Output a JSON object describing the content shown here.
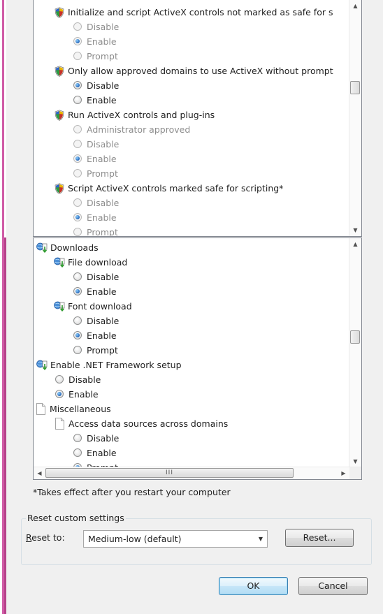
{
  "panel1": {
    "items": [
      {
        "kind": "header",
        "icon": "shield-icon",
        "text": "Initialize and script ActiveX controls not marked as safe for s",
        "indent": 30
      },
      {
        "kind": "radio",
        "text": "Disable",
        "checked": false,
        "dim": true,
        "indent": 57
      },
      {
        "kind": "radio",
        "text": "Enable",
        "checked": true,
        "dim": true,
        "indent": 57
      },
      {
        "kind": "radio",
        "text": "Prompt",
        "checked": false,
        "dim": true,
        "indent": 57
      },
      {
        "kind": "header",
        "icon": "shield-icon",
        "text": "Only allow approved domains to use ActiveX without prompt",
        "indent": 30
      },
      {
        "kind": "radio",
        "text": "Disable",
        "checked": true,
        "dim": false,
        "indent": 57
      },
      {
        "kind": "radio",
        "text": "Enable",
        "checked": false,
        "dim": false,
        "indent": 57
      },
      {
        "kind": "header",
        "icon": "shield-icon",
        "text": "Run ActiveX controls and plug-ins",
        "indent": 30
      },
      {
        "kind": "radio",
        "text": "Administrator approved",
        "checked": false,
        "dim": true,
        "indent": 57
      },
      {
        "kind": "radio",
        "text": "Disable",
        "checked": false,
        "dim": true,
        "indent": 57
      },
      {
        "kind": "radio",
        "text": "Enable",
        "checked": true,
        "dim": true,
        "indent": 57
      },
      {
        "kind": "radio",
        "text": "Prompt",
        "checked": false,
        "dim": true,
        "indent": 57
      },
      {
        "kind": "header",
        "icon": "shield-icon",
        "text": "Script ActiveX controls marked safe for scripting*",
        "indent": 30
      },
      {
        "kind": "radio",
        "text": "Disable",
        "checked": false,
        "dim": true,
        "indent": 57
      },
      {
        "kind": "radio",
        "text": "Enable",
        "checked": true,
        "dim": true,
        "indent": 57
      },
      {
        "kind": "radio",
        "text": "Prompt",
        "checked": false,
        "dim": true,
        "indent": 57
      }
    ]
  },
  "panel2": {
    "items": [
      {
        "kind": "header",
        "icon": "download-icon",
        "text": "Downloads",
        "indent": 4
      },
      {
        "kind": "header",
        "icon": "download-icon",
        "text": "File download",
        "indent": 29
      },
      {
        "kind": "radio",
        "text": "Disable",
        "checked": false,
        "dim": false,
        "indent": 57
      },
      {
        "kind": "radio",
        "text": "Enable",
        "checked": true,
        "dim": false,
        "indent": 57
      },
      {
        "kind": "header",
        "icon": "download-icon",
        "text": "Font download",
        "indent": 29
      },
      {
        "kind": "radio",
        "text": "Disable",
        "checked": false,
        "dim": false,
        "indent": 57
      },
      {
        "kind": "radio",
        "text": "Enable",
        "checked": true,
        "dim": false,
        "indent": 57
      },
      {
        "kind": "radio",
        "text": "Prompt",
        "checked": false,
        "dim": false,
        "indent": 57
      },
      {
        "kind": "header",
        "icon": "download-icon",
        "text": "Enable .NET Framework setup",
        "indent": 4
      },
      {
        "kind": "radio",
        "text": "Disable",
        "checked": false,
        "dim": false,
        "indent": 31
      },
      {
        "kind": "radio",
        "text": "Enable",
        "checked": true,
        "dim": false,
        "indent": 31
      },
      {
        "kind": "header",
        "icon": "document-icon",
        "text": "Miscellaneous",
        "indent": 4
      },
      {
        "kind": "header",
        "icon": "document-icon",
        "text": "Access data sources across domains",
        "indent": 31
      },
      {
        "kind": "radio",
        "text": "Disable",
        "checked": false,
        "dim": false,
        "indent": 57
      },
      {
        "kind": "radio",
        "text": "Enable",
        "checked": false,
        "dim": false,
        "indent": 57
      },
      {
        "kind": "radio",
        "text": "Prompt",
        "checked": true,
        "dim": false,
        "indent": 57
      }
    ],
    "hscroll_grip": "III"
  },
  "scroll": {
    "up_icon": "▲",
    "down_icon": "▼",
    "left_icon": "◀",
    "right_icon": "▶"
  },
  "note": "*Takes effect after you restart your computer",
  "reset_group": {
    "title": "Reset custom settings",
    "reset_to_key": "R",
    "reset_to_rest": "eset to:",
    "selected_value": "Medium-low (default)",
    "reset_button": "Reset..."
  },
  "buttons": {
    "ok": "OK",
    "cancel": "Cancel"
  }
}
